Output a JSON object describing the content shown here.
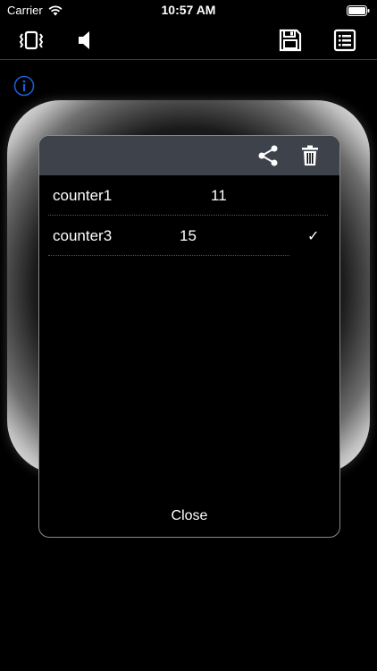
{
  "status_bar": {
    "carrier": "Carrier",
    "time": "10:57 AM"
  },
  "toolbar": {
    "left_icons": [
      "vibrate-icon",
      "speaker-icon"
    ],
    "right_icons": [
      "save-icon",
      "list-icon"
    ]
  },
  "panel": {
    "header_icons": [
      "share-icon",
      "trash-icon"
    ],
    "rows": [
      {
        "name": "counter1",
        "value": "11",
        "selected": false
      },
      {
        "name": "counter3",
        "value": "15",
        "selected": true
      }
    ],
    "close_label": "Close"
  },
  "colors": {
    "background": "#000000",
    "panel_header": "#3e424a",
    "info_blue": "#1e5bd6"
  }
}
